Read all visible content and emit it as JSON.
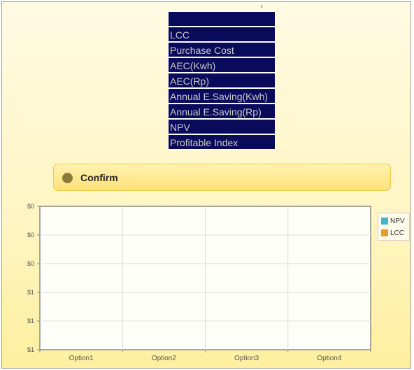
{
  "listbox": {
    "options": [
      "",
      "LCC",
      "Purchase Cost",
      "AEC(Kwh)",
      "AEC(Rp)",
      "Annual E.Saving(Kwh)",
      "Annual E.Saving(Rp)",
      "NPV",
      "Profitable Index"
    ]
  },
  "confirm": {
    "label": "Confirm"
  },
  "legend": {
    "items": [
      {
        "label": "NPV",
        "color": "#3fb7cf"
      },
      {
        "label": "LCC",
        "color": "#e0a030"
      }
    ]
  },
  "chart_data": {
    "type": "bar",
    "categories": [
      "Option1",
      "Option2",
      "Option3",
      "Option4"
    ],
    "series": [
      {
        "name": "NPV",
        "values": [
          0,
          0,
          0,
          0
        ]
      },
      {
        "name": "LCC",
        "values": [
          0,
          0,
          0,
          0
        ]
      }
    ],
    "y_tick_labels": [
      "$1",
      "$1",
      "$1",
      "$0",
      "$0",
      "$0"
    ],
    "grid": true,
    "legend_position": "right"
  }
}
